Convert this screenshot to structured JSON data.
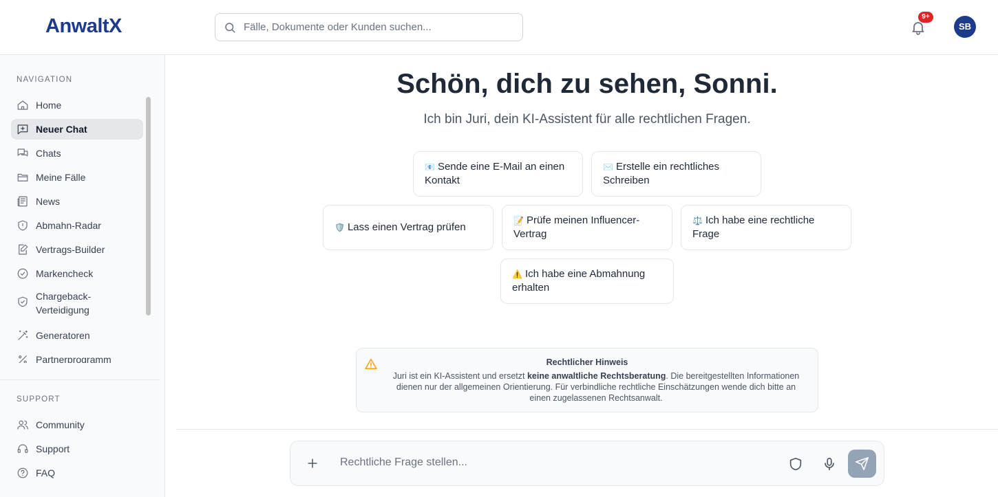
{
  "app": {
    "logo": "AnwaltX"
  },
  "header": {
    "search_placeholder": "Fälle, Dokumente oder Kunden suchen...",
    "notification_badge": "9+",
    "avatar_initials": "SB"
  },
  "sidebar": {
    "nav_title": "NAVIGATION",
    "nav_items": [
      {
        "label": "Home",
        "icon": "home-icon"
      },
      {
        "label": "Neuer Chat",
        "icon": "chat-plus-icon",
        "active": true
      },
      {
        "label": "Chats",
        "icon": "chats-icon"
      },
      {
        "label": "Meine Fälle",
        "icon": "folder-icon"
      },
      {
        "label": "News",
        "icon": "newspaper-icon"
      },
      {
        "label": "Abmahn-Radar",
        "icon": "shield-icon"
      },
      {
        "label": "Vertrags-Builder",
        "icon": "document-edit-icon"
      },
      {
        "label": "Markencheck",
        "icon": "check-circle-icon"
      },
      {
        "label": "Chargeback-Verteidigung",
        "line1": "Chargeback-",
        "line2": "Verteidigung",
        "icon": "shield-check-icon"
      },
      {
        "label": "Generatoren",
        "icon": "magic-wand-icon"
      },
      {
        "label": "Partnerprogramm",
        "icon": "percent-icon"
      }
    ],
    "support_title": "SUPPORT",
    "support_items": [
      {
        "label": "Community",
        "icon": "users-icon"
      },
      {
        "label": "Support",
        "icon": "headset-icon"
      },
      {
        "label": "FAQ",
        "icon": "question-circle-icon"
      }
    ]
  },
  "main": {
    "greeting": "Schön, dich zu sehen, Sonni.",
    "subtitle": "Ich bin Juri, dein KI-Assistent für alle rechtlichen Fragen.",
    "suggestions": [
      {
        "emoji": "📧",
        "line1": "Sende eine E-Mail an einen",
        "line2": "Kontakt"
      },
      {
        "emoji": "✉️",
        "line1": "Erstelle ein rechtliches",
        "line2": "Schreiben"
      },
      {
        "emoji": "🛡️",
        "line1": "Lass einen Vertrag prüfen",
        "line2": ""
      },
      {
        "emoji": "📝",
        "line1": "Prüfe meinen Influencer-",
        "line2": "Vertrag"
      },
      {
        "emoji": "⚖️",
        "line1": "Ich habe eine rechtliche",
        "line2": "Frage"
      },
      {
        "emoji": "⚠️",
        "line1": "Ich habe eine Abmahnung",
        "line2": "erhalten"
      }
    ],
    "notice": {
      "title": "Rechtlicher Hinweis",
      "body_pre": "Juri ist ein KI-Assistent und ersetzt ",
      "body_bold": "keine anwaltliche Rechtsberatung",
      "body_post": ". Die bereitgestellten Informationen dienen nur der allgemeinen Orientierung. Für verbindliche rechtliche Einschätzungen wende dich bitte an einen zugelassenen Rechtsanwalt."
    },
    "chat_input": {
      "placeholder": "Rechtliche Frage stellen..."
    }
  },
  "colors": {
    "brand": "#1e3a8a",
    "badge": "#dc2626",
    "send_button": "#94a3b8",
    "notice_warning": "#f59e0b"
  }
}
